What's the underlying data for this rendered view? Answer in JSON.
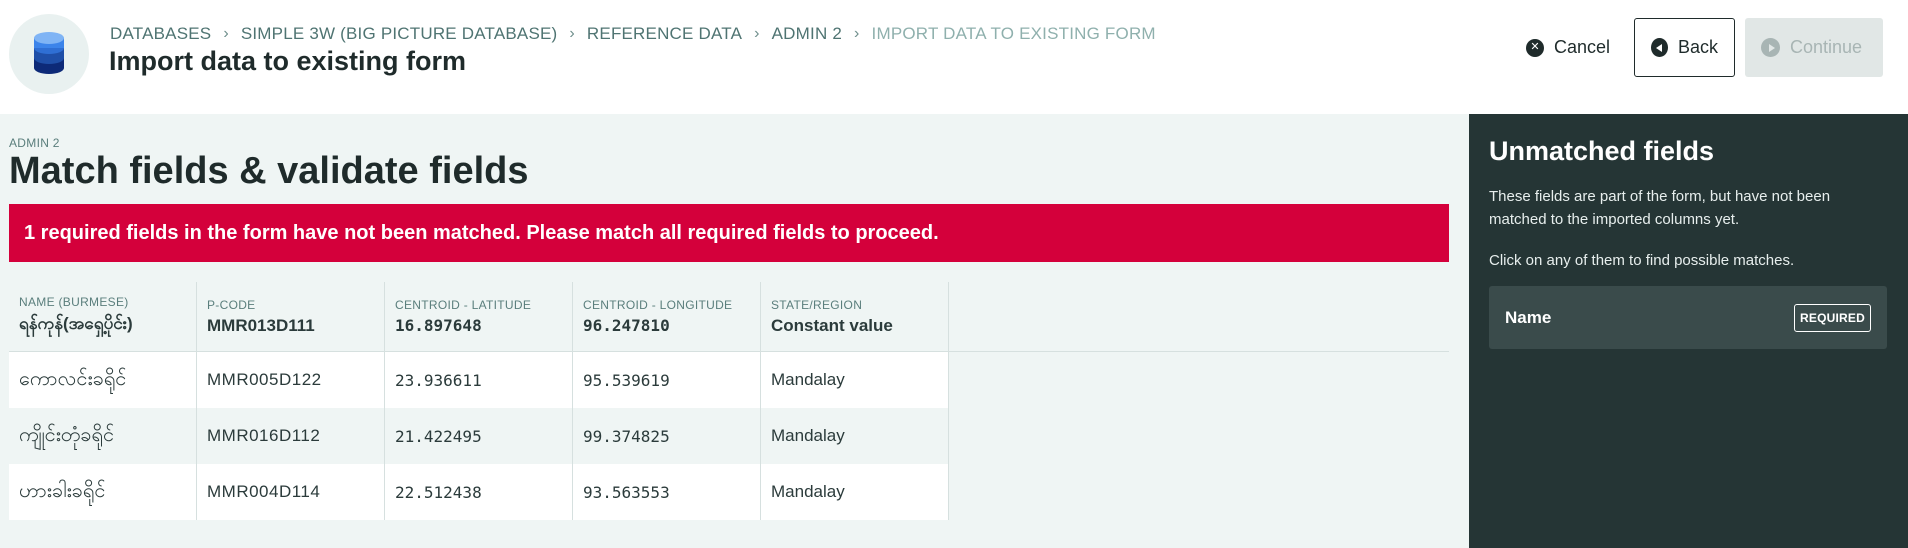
{
  "header": {
    "icon": "database-icon",
    "breadcrumb": [
      {
        "label": "Databases"
      },
      {
        "label": "Simple 3W (Big Picture Database)"
      },
      {
        "label": "Reference Data"
      },
      {
        "label": "Admin 2"
      },
      {
        "label": "Import data to existing form"
      }
    ],
    "title": "Import data to existing form",
    "actions": {
      "cancel": "Cancel",
      "back": "Back",
      "continue": "Continue"
    }
  },
  "main": {
    "eyebrow": "Admin 2",
    "section_title": "Match fields & validate fields",
    "alert": "1 required fields in the form have not been matched. Please match all required fields to proceed.",
    "table": {
      "columns": [
        {
          "label": "Name (Burmese)",
          "value": "ရန်ကုန်(အရှေ့ပိုင်း)"
        },
        {
          "label": "P-Code",
          "value": "MMR013D111"
        },
        {
          "label": "Centroid - Latitude",
          "value": "16.897648"
        },
        {
          "label": "Centroid - Longitude",
          "value": "96.247810"
        },
        {
          "label": "State/Region",
          "value": "Constant value"
        }
      ],
      "rows": [
        [
          "ကောလင်းခရိုင်",
          "MMR005D122",
          "23.936611",
          "95.539619",
          "Mandalay"
        ],
        [
          "ကျိုင်းတုံခရိုင်",
          "MMR016D112",
          "21.422495",
          "99.374825",
          "Mandalay"
        ],
        [
          "ဟားခါးခရိုင်",
          "MMR004D114",
          "22.512438",
          "93.563553",
          "Mandalay"
        ]
      ]
    }
  },
  "side_panel": {
    "title": "Unmatched fields",
    "description": "These fields are part of the form, but have not been matched to the imported columns yet.",
    "hint": "Click on any of them to find possible matches.",
    "fields": [
      {
        "name": "Name",
        "badge": "REQUIRED"
      }
    ]
  },
  "colors": {
    "alert": "#d4003b",
    "panel": "#253535",
    "main_bg": "#eff5f4",
    "accent": "#1f4fa8"
  }
}
